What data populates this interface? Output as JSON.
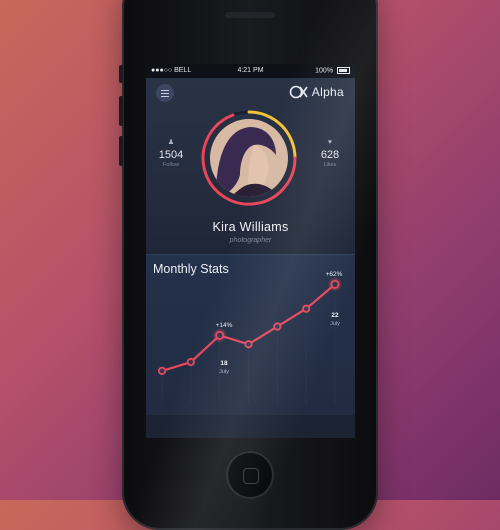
{
  "status_bar": {
    "carrier": "●●●○○ BELL",
    "time": "4:21 PM",
    "battery": "100%"
  },
  "app": {
    "brand_name": "Alpha"
  },
  "profile": {
    "name": "Kira Williams",
    "role": "photographer",
    "follow": {
      "value": "1504",
      "label": "Follow"
    },
    "likes": {
      "value": "628",
      "label": "Likes"
    }
  },
  "monthly_stats": {
    "title": "Monthly Stats",
    "annotations": [
      {
        "change": "+14%",
        "day": "18",
        "month": "July"
      },
      {
        "change": "+62%",
        "day": "22",
        "month": "July"
      }
    ]
  },
  "chart_data": {
    "type": "line",
    "title": "Monthly Stats",
    "x": [
      1,
      2,
      3,
      4,
      5,
      6,
      7
    ],
    "series": [
      {
        "values": [
          10,
          18,
          42,
          34,
          50,
          66,
          88
        ]
      }
    ],
    "ylim": [
      0,
      100
    ],
    "highlighted_points": [
      3,
      7
    ],
    "colors": {
      "line": "#e8475a",
      "point_fill": "#2a3650"
    }
  },
  "colors": {
    "accent": "#e8475a",
    "ring_gold": "#f2c23a",
    "ring_red": "#e8475a",
    "panel": "#212c42"
  }
}
